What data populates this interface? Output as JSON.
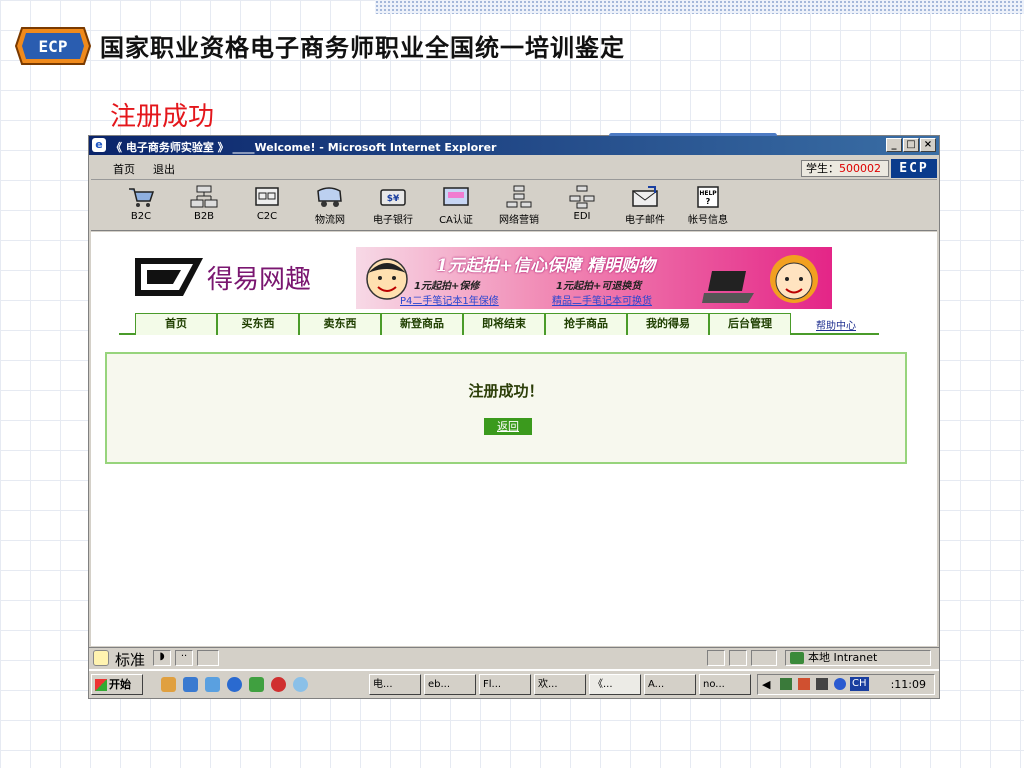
{
  "slide": {
    "title": "国家职业资格电子商务师职业全国统一培训鉴定",
    "subtitle": "注册成功",
    "logo_text": "ECP"
  },
  "window": {
    "title": "《 电子商务师实验室 》 ____Welcome! - Microsoft Internet Explorer",
    "buttons": [
      "_",
      "□",
      "×"
    ]
  },
  "menu": {
    "home": "首页",
    "logout": "退出",
    "student_label": "学生：",
    "student_id": "500002",
    "badge": "ECP"
  },
  "toolbar": [
    {
      "label": "B2C",
      "icon": "cart-icon"
    },
    {
      "label": "B2B",
      "icon": "network-icon"
    },
    {
      "label": "C2C",
      "icon": "c2c-icon"
    },
    {
      "label": "物流网",
      "icon": "truck-icon"
    },
    {
      "label": "电子银行",
      "icon": "bank-icon"
    },
    {
      "label": "CA认证",
      "icon": "certificate-icon"
    },
    {
      "label": "网络营销",
      "icon": "marketing-icon"
    },
    {
      "label": "EDI",
      "icon": "edi-icon"
    },
    {
      "label": "电子邮件",
      "icon": "mail-icon"
    },
    {
      "label": "帐号信息",
      "icon": "help-icon"
    }
  ],
  "site": {
    "brand": "得易网趣",
    "banner": {
      "headline": "1元起拍+信心保障  精明购物",
      "line1": "1元起拍+保修",
      "line2": "1元起拍+可退换货",
      "link1": "P4二手笔记本1年保修",
      "link2": "精品二手笔记本可换货"
    },
    "tabs": [
      "首页",
      "买东西",
      "卖东西",
      "新登商品",
      "即将结束",
      "抢手商品",
      "我的得易",
      "后台管理"
    ],
    "help": "帮助中心",
    "message": "注册成功！",
    "back": "返回"
  },
  "status": {
    "mode": "标准",
    "zone": "本地 Intranet"
  },
  "taskbar": {
    "start": "开始",
    "tasks": [
      "电...",
      "eb...",
      "Fl...",
      "欢...",
      "《...",
      "A...",
      "no..."
    ],
    "tray_label": "CH",
    "clock": ":11:09"
  },
  "colors": {
    "slide_subtitle": "#e4161b",
    "ie_title": "#0a246a",
    "tab_border": "#4a9b2a",
    "banner": "#e42587"
  }
}
